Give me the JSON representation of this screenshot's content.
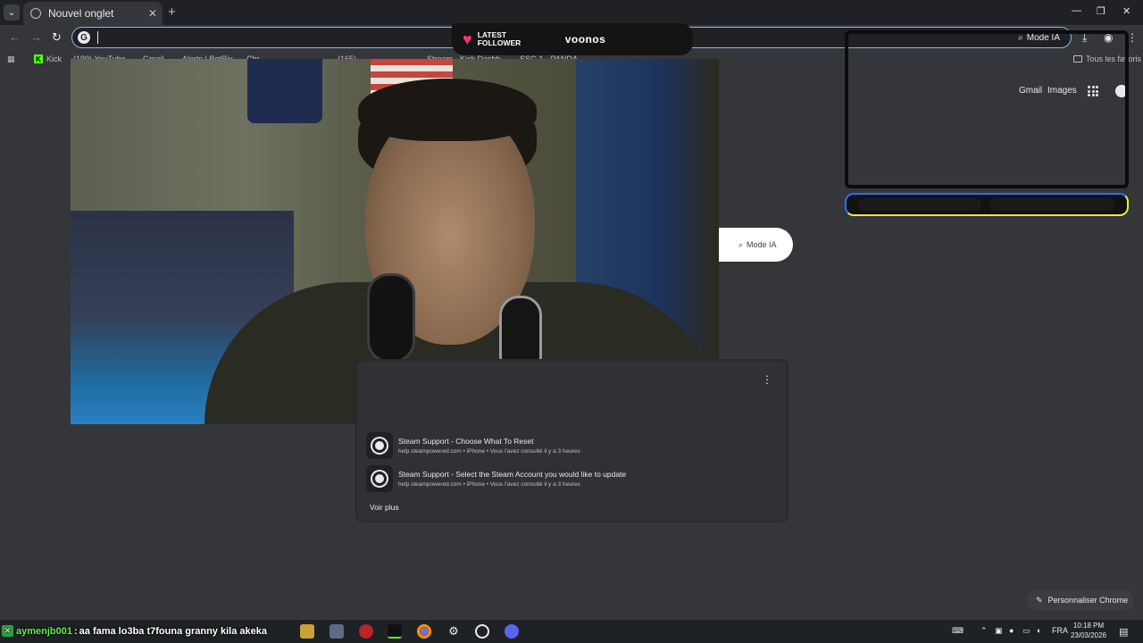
{
  "browser": {
    "tab": {
      "title": "Nouvel onglet"
    },
    "new_tab_label": "+",
    "window_controls": {
      "minimize": "—",
      "maximize": "❐",
      "close": "✕"
    },
    "omnibox": {
      "value": "",
      "mode_ai_label": "Mode IA"
    },
    "bookmarks": [
      {
        "label": "Kick"
      },
      {
        "label": "(199) YouTube"
      },
      {
        "label": "Gmail"
      },
      {
        "label": "Alerts | BotRix"
      },
      {
        "label": "Chr..."
      },
      {
        "label": "(165)"
      },
      {
        "label": "Stream - Kick Dashb..."
      },
      {
        "label": "SSC-1 - PANDA"
      }
    ],
    "all_bookmarks_label": "Tous les favoris"
  },
  "ntp": {
    "gmail_label": "Gmail",
    "images_label": "Images",
    "mode_ai_label": "Mode IA",
    "suggestions": [
      {
        "title": "Steam Support - Choose What To Reset",
        "subtitle": "help.steampowered.com • iPhone • Vous l'avez consulté il y a 3 heures"
      },
      {
        "title": "Steam Support - Select the Steam Account you would like to update",
        "subtitle": "help.steampowered.com • iPhone • Vous l'avez consulté il y a 3 heures"
      }
    ],
    "see_more_label": "Voir plus",
    "customize_label": "Personnaliser Chrome"
  },
  "overlay": {
    "follower_label_line1": "LATEST",
    "follower_label_line2": "FOLLOWER",
    "follower_name": "voonos",
    "chat": {
      "user": "aymenjb001",
      "message": "aa fama lo3ba t7founa granny kila akeka"
    }
  },
  "taskbar": {
    "language": "FRA",
    "time": "10:18 PM",
    "date": "23/03/2026"
  },
  "colors": {
    "background": "#35363a",
    "accent_blue": "#8ab4f8",
    "follower_heart": "#ff2e7e",
    "chat_user": "#5ef34a"
  }
}
